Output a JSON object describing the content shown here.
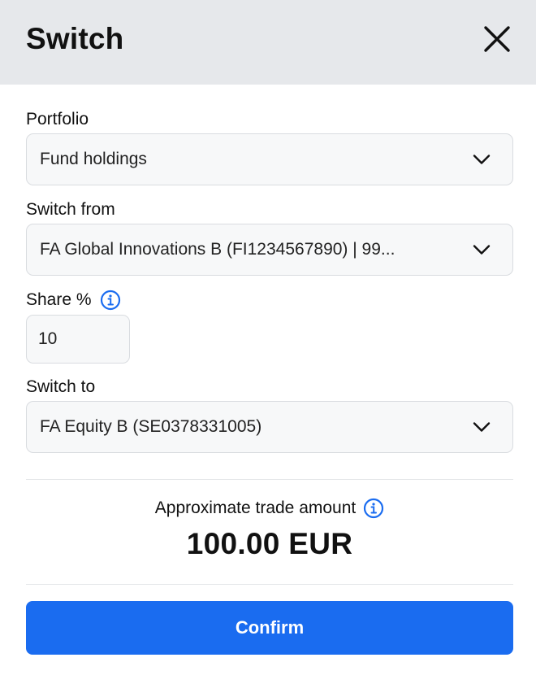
{
  "dialog": {
    "title": "Switch"
  },
  "portfolio": {
    "label": "Portfolio",
    "value": "Fund holdings"
  },
  "switch_from": {
    "label": "Switch from",
    "value": "FA Global Innovations B (FI1234567890) | 99..."
  },
  "share": {
    "label": "Share %",
    "value": "10"
  },
  "switch_to": {
    "label": "Switch to",
    "value": "FA Equity B (SE0378331005)"
  },
  "trade_amount": {
    "label": "Approximate trade amount",
    "value": "100.00 EUR"
  },
  "confirm": {
    "label": "Confirm"
  },
  "colors": {
    "accent": "#1a6cf0",
    "header_bg": "#e6e8eb",
    "field_bg": "#f7f8f9"
  },
  "icons": {
    "close": "close-icon",
    "chevron": "chevron-down-icon",
    "info": "info-icon"
  }
}
